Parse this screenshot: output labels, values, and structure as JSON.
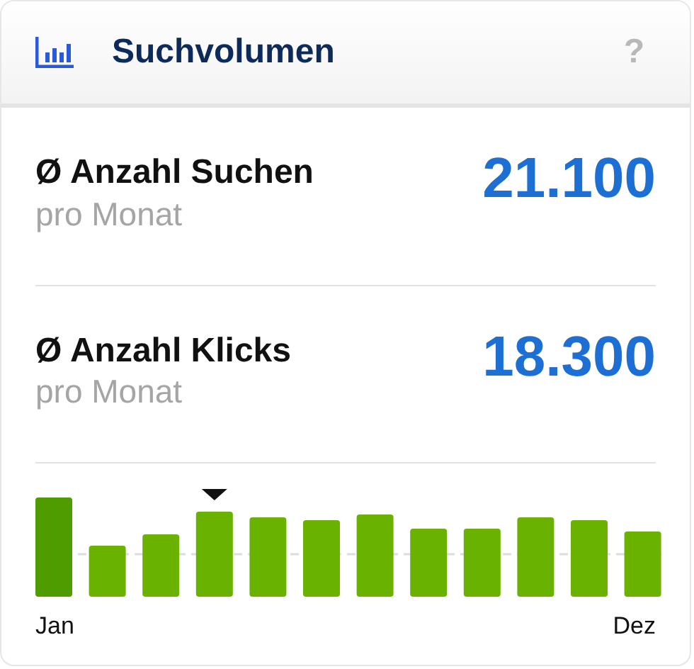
{
  "card": {
    "title": "Suchvolumen",
    "help": "?"
  },
  "metrics": [
    {
      "symbol": "Ø",
      "label": "Anzahl Suchen",
      "sublabel": "pro Monat",
      "value": "21.100"
    },
    {
      "symbol": "Ø",
      "label": "Anzahl Klicks",
      "sublabel": "pro Monat",
      "value": "18.300"
    }
  ],
  "chart": {
    "start_label": "Jan",
    "end_label": "Dez"
  }
}
